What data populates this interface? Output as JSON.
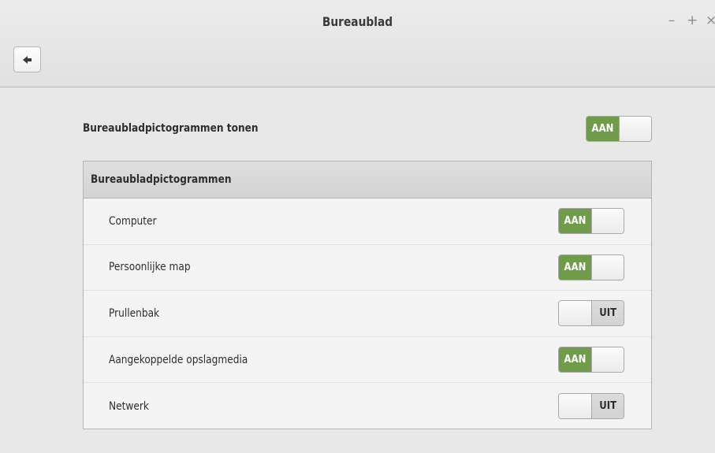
{
  "window": {
    "title": "Bureaublad",
    "controls": {
      "minimize": "–",
      "maximize": "+",
      "close": "×"
    }
  },
  "toolbar": {
    "back_icon": "back-arrow-icon"
  },
  "main_setting": {
    "label": "Bureaubladpictogrammen tonen",
    "state": "AAN",
    "on": true
  },
  "section": {
    "title": "Bureaubladpictogrammen",
    "items": [
      {
        "label": "Computer",
        "state": "AAN",
        "on": true
      },
      {
        "label": "Persoonlijke map",
        "state": "AAN",
        "on": true
      },
      {
        "label": "Prullenbak",
        "state": "UIT",
        "on": false
      },
      {
        "label": "Aangekoppelde opslagmedia",
        "state": "AAN",
        "on": true
      },
      {
        "label": "Netwerk",
        "state": "UIT",
        "on": false
      }
    ]
  },
  "colors": {
    "on_accent": "#6f9b4b",
    "background": "#e8e8e8"
  }
}
